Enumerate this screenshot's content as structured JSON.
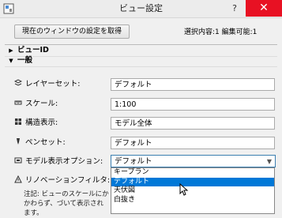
{
  "window": {
    "title": "ビュー設定",
    "help_glyph": "?",
    "close_glyph": "✕"
  },
  "toolbar": {
    "fetch_label": "現在のウィンドウの設定を取得",
    "selection_status": "選択内容:1 編集可能:1"
  },
  "sections": {
    "view_id": "ビューID",
    "general": "一般"
  },
  "rows": [
    {
      "label": "レイヤーセット:",
      "value": "デフォルト",
      "icon": "layers-icon"
    },
    {
      "label": "スケール:",
      "value": "1:100",
      "icon": "scale-icon"
    },
    {
      "label": "構造表示:",
      "value": "モデル全体",
      "icon": "structure-icon"
    },
    {
      "label": "ペンセット:",
      "value": "デフォルト",
      "icon": "pen-icon"
    },
    {
      "label": "モデル表示オプション:",
      "value": "デフォルト",
      "icon": "model-display-icon"
    },
    {
      "label": "リノベーションフィルタ:",
      "value": "",
      "icon": "renovation-icon"
    }
  ],
  "dropdown": {
    "options": [
      "キープラン",
      "デフォルト",
      "天伏図",
      "白抜き"
    ],
    "selected": "デフォルト"
  },
  "note": "注記: ビューのスケールにかかわらず、づいて表示されます。",
  "colors": {
    "close": "#e81123",
    "selection": "#0078d7"
  }
}
